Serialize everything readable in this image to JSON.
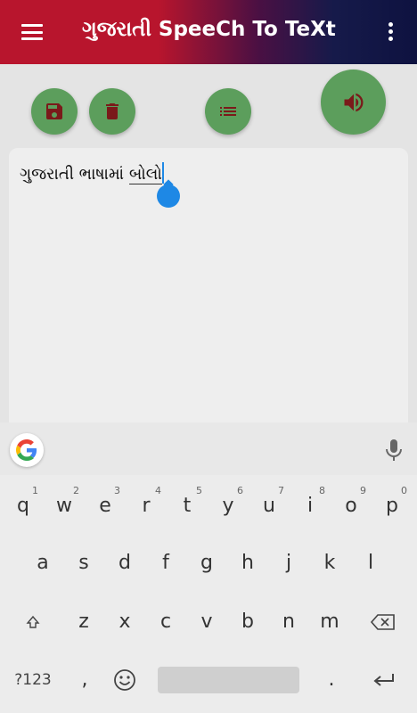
{
  "app_bar": {
    "title": "ગુજરાતી SpeeCh To TeXt",
    "menu_icon": "hamburger-menu-icon",
    "overflow_icon": "more-vert-icon",
    "gradient_colors": [
      "#b8152d",
      "#161a4a"
    ]
  },
  "toolbar": {
    "save_icon": "save-floppy-icon",
    "delete_icon": "trash-icon",
    "list_icon": "list-icon",
    "speak_icon": "volume-up-icon",
    "button_color": "#5c9e5c",
    "icon_color": "#7a1a1a"
  },
  "editor": {
    "text_plain": "ગુજરાતી ભાષામાં ",
    "text_underlined": "બોલો",
    "cursor_color": "#1e88e5"
  },
  "keyboard": {
    "suggest": {
      "logo": "google-g-icon",
      "mic_icon": "mic-icon"
    },
    "row1": [
      {
        "ch": "q",
        "sup": "1"
      },
      {
        "ch": "w",
        "sup": "2"
      },
      {
        "ch": "e",
        "sup": "3"
      },
      {
        "ch": "r",
        "sup": "4"
      },
      {
        "ch": "t",
        "sup": "5"
      },
      {
        "ch": "y",
        "sup": "6"
      },
      {
        "ch": "u",
        "sup": "7"
      },
      {
        "ch": "i",
        "sup": "8"
      },
      {
        "ch": "o",
        "sup": "9"
      },
      {
        "ch": "p",
        "sup": "0"
      }
    ],
    "row2": [
      "a",
      "s",
      "d",
      "f",
      "g",
      "h",
      "j",
      "k",
      "l"
    ],
    "row3": [
      "z",
      "x",
      "c",
      "v",
      "b",
      "n",
      "m"
    ],
    "row4": {
      "symbols": "?123",
      "comma": ",",
      "period": "."
    }
  }
}
